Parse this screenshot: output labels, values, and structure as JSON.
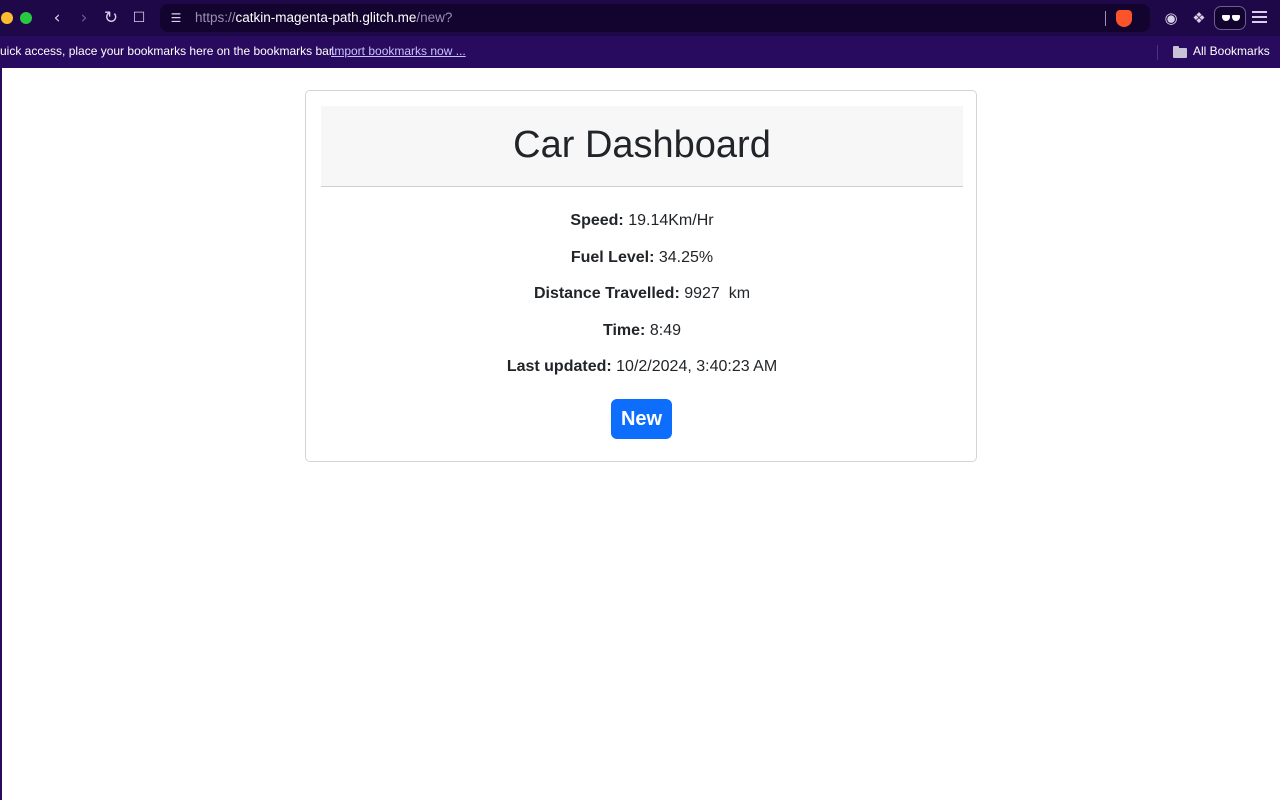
{
  "browser": {
    "url_scheme": "https://",
    "url_host": "catkin-magenta-path.glitch.me",
    "url_path": "/new?",
    "bookmarks_bar_text": "uick access, place your bookmarks here on the bookmarks bar.",
    "import_link": "Import bookmarks now ...",
    "all_bookmarks": "All Bookmarks",
    "icons": [
      "back-icon",
      "forward-icon",
      "reload-icon",
      "bookmark-icon",
      "site-settings-icon",
      "brave-shields-icon",
      "extension-icon",
      "puzzle-icon",
      "private-glasses-icon",
      "menu-icon",
      "folder-icon"
    ]
  },
  "dashboard": {
    "title": "Car Dashboard",
    "stats": [
      {
        "label": "Speed:",
        "value": "19.14Km/Hr"
      },
      {
        "label": "Fuel Level:",
        "value": "34.25%"
      },
      {
        "label": "Distance Travelled:",
        "value": "9927  km"
      },
      {
        "label": "Time:",
        "value": "8:49"
      },
      {
        "label": "Last updated:",
        "value": "10/2/2024, 3:40:23 AM"
      }
    ],
    "button_label": "New",
    "colors": {
      "button": "#0d6efd",
      "header_bg": "#f7f7f7",
      "text": "#212529"
    }
  }
}
